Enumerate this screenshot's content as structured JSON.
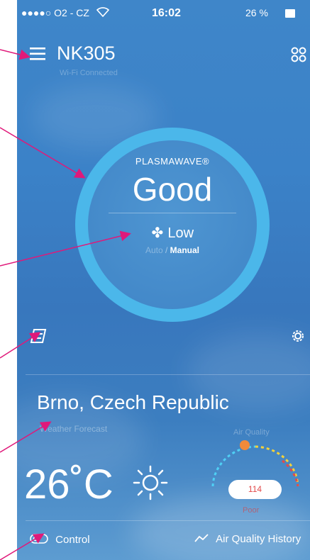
{
  "status_bar": {
    "carrier": "●●●●○ O2 - CZ",
    "time": "16:02",
    "battery": "26 %"
  },
  "header": {
    "device_name": "NK305",
    "connection": "Wi-Fi Connected",
    "menu_icon": "menu-icon",
    "devices_icon": "grid-icon"
  },
  "status_circle": {
    "label": "PLASMAWAVE®",
    "air_status": "Good",
    "fan_speed": "Low",
    "mode_auto": "Auto",
    "mode_separator": " / ",
    "mode_manual": "Manual"
  },
  "controls": {
    "filter_icon": "filter-icon",
    "settings_icon": "gear-icon"
  },
  "weather": {
    "location": "Brno, Czech Republic",
    "forecast_label": "Weather Forecast",
    "temperature": "26˚C",
    "weather_icon": "sun-icon"
  },
  "air_quality": {
    "label": "Air Quality",
    "value": "114",
    "rating": "Poor",
    "colors": {
      "good": "#4fd0f5",
      "moderate": "#f3d23a",
      "poor": "#e24b4b",
      "marker": "#f08a3a"
    }
  },
  "bottom_nav": {
    "control_label": "Control",
    "history_label": "Air Quality History"
  },
  "colors": {
    "annotation_arrows": "#e0197a",
    "ring": "#4bb7ea",
    "background": "#3b80c4"
  }
}
